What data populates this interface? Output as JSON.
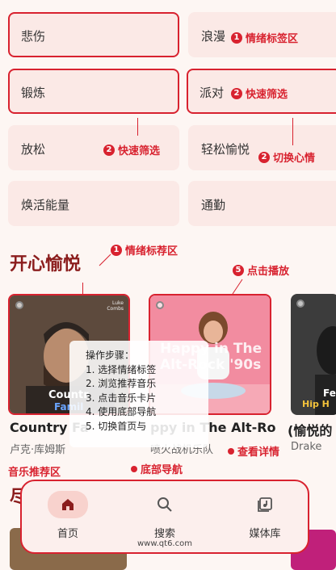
{
  "moods": [
    {
      "label": "悲伤"
    },
    {
      "label": "浪漫"
    },
    {
      "label": "锻炼"
    },
    {
      "label": "派对"
    },
    {
      "label": "放松"
    },
    {
      "label": "轻松愉悦"
    },
    {
      "label": "焕活能量"
    },
    {
      "label": "通勤"
    }
  ],
  "annotations": {
    "mood_area": {
      "num": "1",
      "text": "情绪标签区"
    },
    "quick_filter_1": {
      "num": "2",
      "text": "快速筛选"
    },
    "quick_filter_2": {
      "num": "2",
      "text": "快速筛选"
    },
    "switch_mood": {
      "num": "2",
      "text": "切换心情"
    },
    "mood_recommend": {
      "num": "1",
      "text": "情绪标荐区"
    },
    "click_play": {
      "num": "5",
      "text": "点击播放"
    },
    "view_detail": {
      "text": "查看详情"
    },
    "music_recommend": {
      "text": "音乐推荐区"
    },
    "bottom_nav": {
      "text": "底部导航"
    }
  },
  "section": {
    "title": "开心愉悦"
  },
  "cards": [
    {
      "title": "Country Fa",
      "subtitle": "卢克·库姆斯",
      "art_top": "Luke\nCombs",
      "art_line1": "Countr",
      "art_line2": "Famil"
    },
    {
      "title": "ppy in The Alt-Ro",
      "subtitle": "喷火战机乐队",
      "art_line1": "Happy in The",
      "art_line2": "Alt-Rock '90s"
    },
    {
      "title": "(愉悦的",
      "subtitle": "Drake",
      "art_line1": "Fe",
      "art_line2": "Hip H"
    }
  ],
  "steps": {
    "title": "操作步骤：",
    "items": [
      "1. 选择情绪标签",
      "2. 浏览推荐音乐",
      "3. 点击音乐卡片",
      "4. 使用底部导航",
      "5. 切换首页与"
    ]
  },
  "partial_heading": "尽",
  "nav": [
    {
      "label": "首页",
      "icon": "home-icon",
      "active": true
    },
    {
      "label": "搜索",
      "icon": "search-icon",
      "active": false
    },
    {
      "label": "媒体库",
      "icon": "library-icon",
      "active": false
    }
  ],
  "watermark": "www.qt6.com",
  "colors": {
    "accent": "#d8222f",
    "tile_bg": "#fbe9e6",
    "title": "#8b1d1d"
  }
}
